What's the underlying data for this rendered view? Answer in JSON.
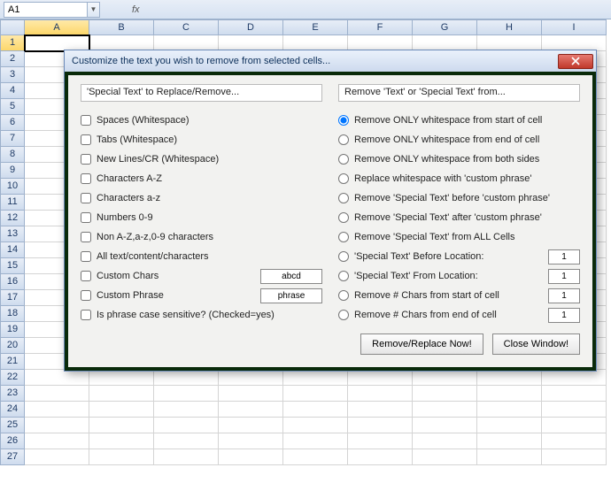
{
  "formula_bar": {
    "name_box": "A1",
    "fx_label": "fx"
  },
  "columns": [
    "A",
    "B",
    "C",
    "D",
    "E",
    "F",
    "G",
    "H",
    "I"
  ],
  "row_count": 27,
  "active_cell": {
    "col": 0,
    "row": 0
  },
  "dialog": {
    "title": "Customize the text you wish to remove from selected cells...",
    "left": {
      "group_title": "'Special Text' to Replace/Remove...",
      "options": [
        "Spaces (Whitespace)",
        "Tabs (Whitespace)",
        "New Lines/CR (Whitespace)",
        "Characters A-Z",
        "Characters a-z",
        "Numbers 0-9",
        "Non A-Z,a-z,0-9 characters",
        "All text/content/characters"
      ],
      "custom_chars_label": "Custom Chars",
      "custom_chars_value": "abcd",
      "custom_phrase_label": "Custom Phrase",
      "custom_phrase_value": "phrase",
      "case_label": "Is phrase case sensitive? (Checked=yes)"
    },
    "right": {
      "group_title": "Remove 'Text' or 'Special Text' from...",
      "options": [
        {
          "label": "Remove ONLY whitespace from start of cell",
          "checked": true,
          "num": null
        },
        {
          "label": "Remove ONLY whitespace from end of cell",
          "checked": false,
          "num": null
        },
        {
          "label": "Remove ONLY whitespace from both sides",
          "checked": false,
          "num": null
        },
        {
          "label": "Replace whitespace with 'custom phrase'",
          "checked": false,
          "num": null
        },
        {
          "label": "Remove 'Special Text' before 'custom phrase'",
          "checked": false,
          "num": null
        },
        {
          "label": "Remove 'Special Text' after 'custom phrase'",
          "checked": false,
          "num": null
        },
        {
          "label": "Remove 'Special Text' from ALL Cells",
          "checked": false,
          "num": null
        },
        {
          "label": "'Special Text' Before Location:",
          "checked": false,
          "num": "1"
        },
        {
          "label": "'Special Text' From Location:",
          "checked": false,
          "num": "1"
        },
        {
          "label": "Remove # Chars from start of cell",
          "checked": false,
          "num": "1"
        },
        {
          "label": "Remove # Chars from end of cell",
          "checked": false,
          "num": "1"
        }
      ],
      "remove_btn": "Remove/Replace Now!",
      "close_btn": "Close Window!"
    }
  }
}
